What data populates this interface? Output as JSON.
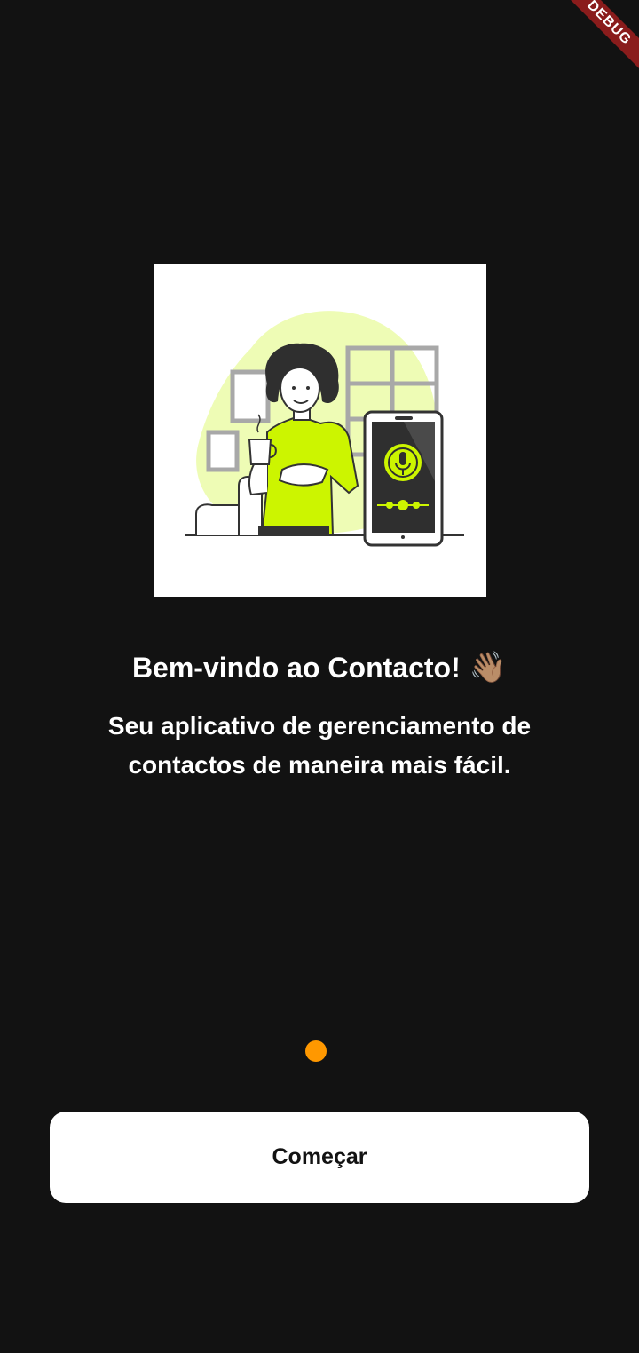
{
  "debug_banner": {
    "label": "DEBUG"
  },
  "onboarding": {
    "title": "Bem-vindo ao Contacto!",
    "title_emoji": "👋🏽",
    "subtitle": "Seu aplicativo de gerenciamento de contactos de maneira mais fácil.",
    "illustration_icon": "woman-with-phone-voice-assistant-illustration"
  },
  "page_indicator": {
    "current_page": 1,
    "total_pages": 1,
    "active_color": "#FF9800"
  },
  "actions": {
    "start_label": "Começar"
  },
  "colors": {
    "background": "#121212",
    "accent": "#CCF500",
    "button_bg": "#FFFFFF",
    "button_text": "#121212"
  }
}
